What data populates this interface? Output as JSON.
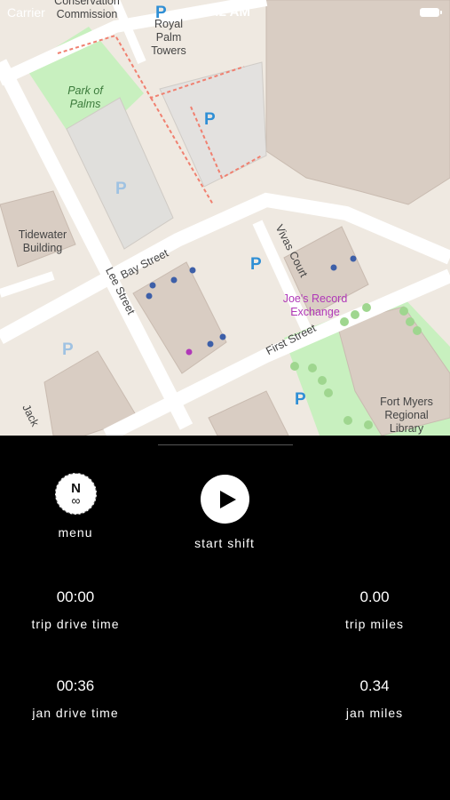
{
  "status_bar": {
    "carrier": "Carrier",
    "time": "8:42 AM"
  },
  "map": {
    "labels": {
      "conservation": "Conservation\nCommission",
      "royal_palm": "Royal\nPalm\nTowers",
      "park_of_palms": "Park of\nPalms",
      "tidewater": "Tidewater\nBuilding",
      "bay_street": "Bay Street",
      "lee_street": "Lee Street",
      "vivas_court": "Vivas Court",
      "first_street": "First Street",
      "joes_record": "Joe's Record\nExchange",
      "fort_myers_library": "Fort Myers\nRegional\nLibrary",
      "jackson": "Jack"
    },
    "parking_symbol": "P"
  },
  "controls": {
    "menu_label": "menu",
    "menu_icon_top": "N",
    "menu_icon_bottom": "∞",
    "start_shift_label": "start shift"
  },
  "stats": {
    "trip_drive_time": {
      "value": "00:00",
      "label": "trip drive time"
    },
    "trip_miles": {
      "value": "0.00",
      "label": "trip miles"
    },
    "jan_drive_time": {
      "value": "00:36",
      "label": "jan drive time"
    },
    "jan_miles": {
      "value": "0.34",
      "label": "jan miles"
    }
  },
  "colors": {
    "panel_bg": "#000000",
    "map_bg": "#f0ece6",
    "park": "#c8f0bf",
    "building": "#d9cdc3",
    "parking_blue": "#2f8fd5",
    "poi_purple": "#b038b8"
  }
}
